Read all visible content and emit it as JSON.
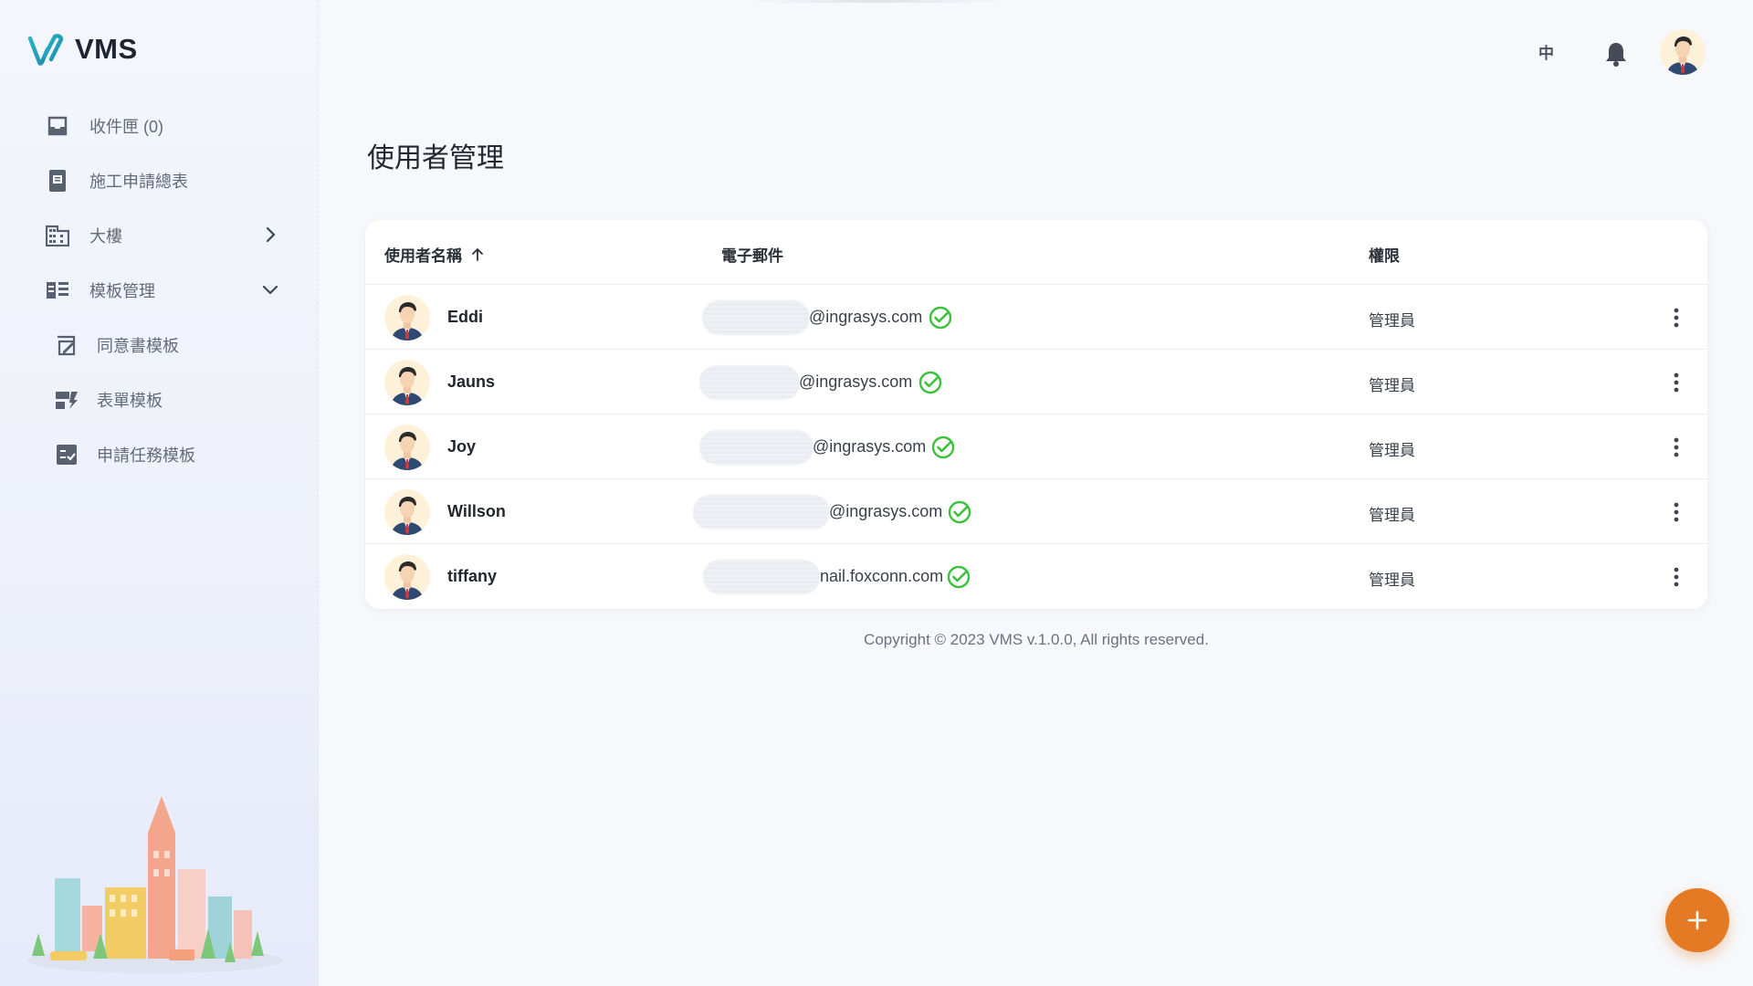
{
  "app": {
    "name": "VMS"
  },
  "sidebar": {
    "items": [
      {
        "label": "收件匣 (0)",
        "icon": "inbox-icon"
      },
      {
        "label": "施工申請總表",
        "icon": "form-list-icon"
      },
      {
        "label": "大樓",
        "icon": "building-icon",
        "chevron": "chevron-right-icon"
      },
      {
        "label": "模板管理",
        "icon": "template-icon",
        "chevron": "chevron-down-icon"
      }
    ],
    "sub_items": [
      {
        "label": "同意書模板",
        "icon": "consent-icon"
      },
      {
        "label": "表單模板",
        "icon": "form-template-icon"
      },
      {
        "label": "申請任務模板",
        "icon": "task-template-icon"
      }
    ]
  },
  "header": {
    "language": "中",
    "bell_icon": "bell-icon"
  },
  "page": {
    "title": "使用者管理"
  },
  "table": {
    "columns": {
      "user": "使用者名稱",
      "email": "電子郵件",
      "role": "權限"
    },
    "rows": [
      {
        "name": "Eddi",
        "email": "@ingrasys.com",
        "role": "管理員"
      },
      {
        "name": "Jauns",
        "email": "@ingrasys.com",
        "role": "管理員"
      },
      {
        "name": "Joy",
        "email": "@ingrasys.com",
        "role": "管理員"
      },
      {
        "name": "Willson",
        "email": "@ingrasys.com",
        "role": "管理員"
      },
      {
        "name": "tiffany",
        "email": "nail.foxconn.com",
        "role": "管理員"
      }
    ]
  },
  "footer": {
    "copyright": "Copyright © 2023 VMS v.1.0.0, All rights reserved."
  },
  "fab": {
    "label": "+"
  },
  "colors": {
    "accent": "#e47a23",
    "verified": "#3cc13b",
    "brand": "#1aa9b8"
  }
}
